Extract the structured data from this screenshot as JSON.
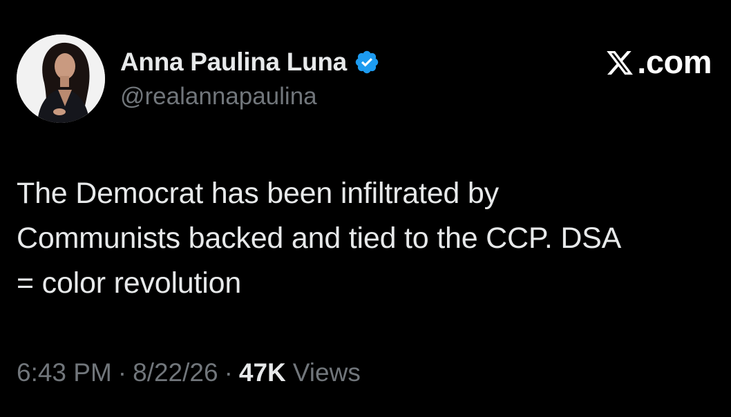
{
  "author": {
    "display_name": "Anna Paulina Luna",
    "handle": "@realannapaulina",
    "verified": true,
    "verified_color": "#1d9bf0",
    "avatar_icon": "profile-photo"
  },
  "brand": {
    "label": ".com",
    "icon": "x-logo-icon"
  },
  "tweet": {
    "text": "The Democrat has been infiltrated by\nCommunists backed and tied to the CCP. DSA\n= color revolution"
  },
  "meta": {
    "time": "6:43 PM",
    "separator": "·",
    "date": "8/22/26",
    "views_count": "47K",
    "views_label": "Views"
  },
  "colors": {
    "background": "#000000",
    "primary_text": "#e7e9ea",
    "secondary_text": "#71767b",
    "accent": "#1d9bf0"
  }
}
